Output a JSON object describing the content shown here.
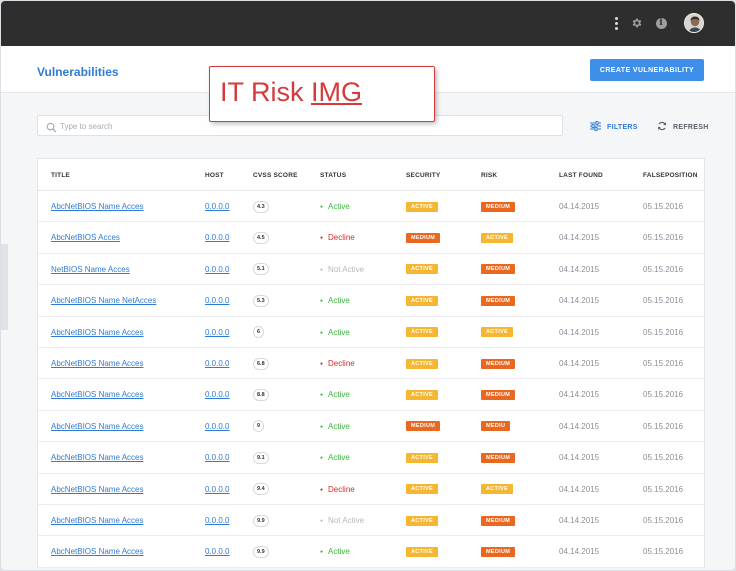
{
  "page": {
    "title": "Vulnerabilities",
    "create_button": "CREATE VULNERABILITY"
  },
  "watermark": {
    "prefix": "IT Risk ",
    "underlined": "IMG",
    "color": "#d63a3a"
  },
  "search": {
    "placeholder": "Type to search"
  },
  "toolbar": {
    "filters_label": "FILTERS",
    "refresh_label": "REFRESH"
  },
  "icons": {
    "menu": "kebab-menu-icon",
    "settings": "gear-icon",
    "info": "info-icon",
    "user": "avatar",
    "search": "search-icon",
    "filters": "sliders-icon",
    "refresh": "refresh-icon"
  },
  "colors": {
    "accent": "#3d8fea",
    "link": "#2f7bd6",
    "active_status": "#3bb43b",
    "decline_status": "#d52a2a",
    "not_active_status": "#b4b9be",
    "badge_active": "#f5b731",
    "badge_medium": "#ea6720",
    "topbar": "#2e2e2e"
  },
  "table": {
    "columns": [
      "TITLE",
      "HOST",
      "CVSS SCORE",
      "STATUS",
      "SECURITY",
      "RISK",
      "LAST FOUND",
      "FALSEPOSITION"
    ],
    "rows": [
      {
        "title": "AbcNetBIOS Name Acces",
        "host": "0.0.0.0",
        "cvss": "4.3",
        "status": "Active",
        "security": "ACTIVE",
        "risk": "MEDIUM",
        "last_found": "04.14.2015",
        "falseposition": "05.15.2016"
      },
      {
        "title": "AbcNetBIOS Acces",
        "host": "0.0.0.0",
        "cvss": "4.5",
        "status": "Decline",
        "security": "MEDIUM",
        "risk": "ACTIVE",
        "last_found": "04.14.2015",
        "falseposition": "05.15.2016"
      },
      {
        "title": "NetBIOS Name Acces",
        "host": "0.0.0.0",
        "cvss": "5.1",
        "status": "Not Active",
        "security": "ACTIVE",
        "risk": "MEDIUM",
        "last_found": "04.14.2015",
        "falseposition": "05.15.2016"
      },
      {
        "title": "AbcNetBIOS Name NetAcces",
        "host": "0.0.0.0",
        "cvss": "5.3",
        "status": "Active",
        "security": "ACTIVE",
        "risk": "MEDIUM",
        "last_found": "04.14.2015",
        "falseposition": "05.15.2016"
      },
      {
        "title": "AbcNetBIOS Name Acces",
        "host": "0.0.0.0",
        "cvss": "6",
        "status": "Active",
        "security": "ACTIVE",
        "risk": "ACTIVE",
        "last_found": "04.14.2015",
        "falseposition": "05.15.2016"
      },
      {
        "title": "AbcNetBIOS Name Acces",
        "host": "0.0.0.0",
        "cvss": "6.8",
        "status": "Decline",
        "security": "ACTIVE",
        "risk": "MEDIUM",
        "last_found": "04.14.2015",
        "falseposition": "05.15.2016"
      },
      {
        "title": "AbcNetBIOS Name Acces",
        "host": "0.0.0.0",
        "cvss": "8.8",
        "status": "Active",
        "security": "ACTIVE",
        "risk": "MEDIUM",
        "last_found": "04.14.2015",
        "falseposition": "05.15.2016"
      },
      {
        "title": "AbcNetBIOS Name Acces",
        "host": "0.0.0.0",
        "cvss": "9",
        "status": "Active",
        "security": "MEDIUM",
        "risk": "MEDIU",
        "last_found": "04.14.2015",
        "falseposition": "05.15.2016"
      },
      {
        "title": "AbcNetBIOS Name Acces",
        "host": "0.0.0.0",
        "cvss": "9.1",
        "status": "Active",
        "security": "ACTIVE",
        "risk": "MEDIUM",
        "last_found": "04.14.2015",
        "falseposition": "05.15.2016"
      },
      {
        "title": "AbcNetBIOS Name Acces",
        "host": "0.0.0.0",
        "cvss": "9.4",
        "status": "Decline",
        "security": "ACTIVE",
        "risk": "ACTIVE",
        "last_found": "04.14.2015",
        "falseposition": "05.15.2016"
      },
      {
        "title": "AbcNetBIOS Name Acces",
        "host": "0.0.0.0",
        "cvss": "9.9",
        "status": "Not Active",
        "security": "ACTIVE",
        "risk": "MEDIUM",
        "last_found": "04.14.2015",
        "falseposition": "05.15.2016"
      },
      {
        "title": "AbcNetBIOS Name Acces",
        "host": "0.0.0.0",
        "cvss": "9.9",
        "status": "Active",
        "security": "ACTIVE",
        "risk": "MEDIUM",
        "last_found": "04.14.2015",
        "falseposition": "05.15.2016"
      }
    ]
  }
}
